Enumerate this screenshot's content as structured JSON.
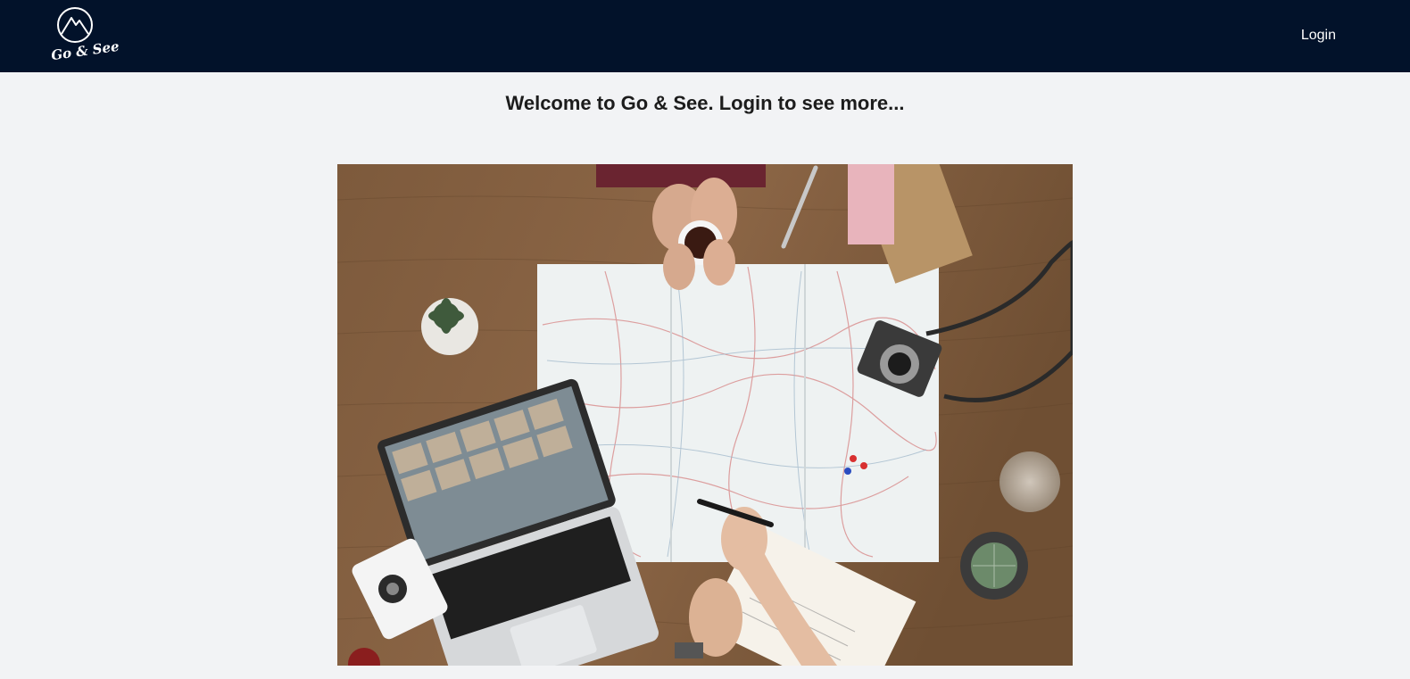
{
  "navbar": {
    "logo_text": "Go & See",
    "login_label": "Login"
  },
  "main": {
    "heading": "Welcome to Go & See. Login to see more..."
  },
  "colors": {
    "navbar_bg": "#02122a",
    "page_bg": "#f2f3f5"
  }
}
